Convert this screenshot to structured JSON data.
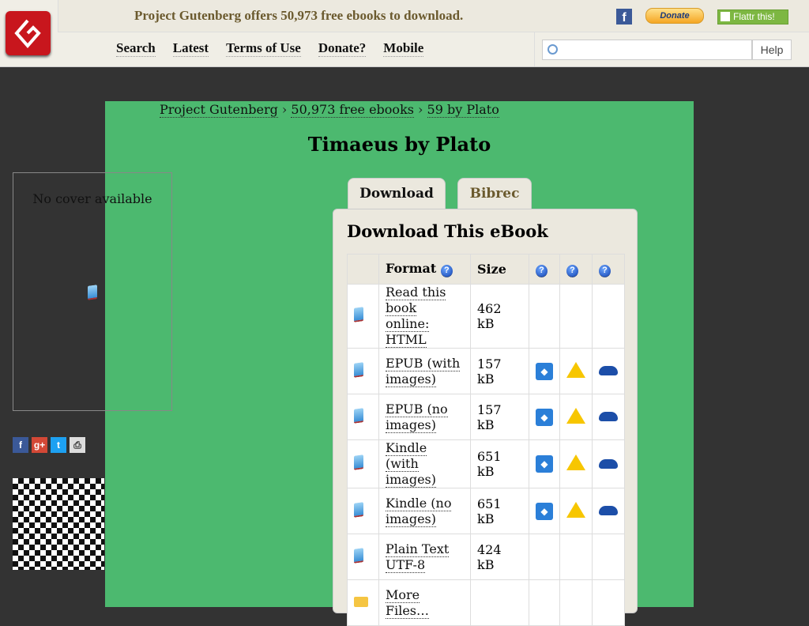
{
  "header": {
    "tagline": "Project Gutenberg offers 50,973 free ebooks to download.",
    "donate": "Donate",
    "flattr": "Flattr this!",
    "facebook": "f",
    "nav": [
      "Search",
      "Latest",
      "Terms of Use",
      "Donate?",
      "Mobile"
    ],
    "search_placeholder": "",
    "help": "Help"
  },
  "breadcrumb": [
    "Project Gutenberg",
    "50,973 free ebooks",
    "59 by Plato"
  ],
  "title": "Timaeus by Plato",
  "cover": "No cover available",
  "tabs": [
    "Download",
    "Bibrec"
  ],
  "download": {
    "heading": "Download This eBook",
    "columns": [
      "Format",
      "Size"
    ],
    "rows": [
      {
        "format": "Read this book online: HTML",
        "size": "462 kB",
        "cloud": false
      },
      {
        "format": "EPUB (with images)",
        "size": "157 kB",
        "cloud": true
      },
      {
        "format": "EPUB (no images)",
        "size": "157 kB",
        "cloud": true
      },
      {
        "format": "Kindle (with images)",
        "size": "651 kB",
        "cloud": true
      },
      {
        "format": "Kindle (no images)",
        "size": "651 kB",
        "cloud": true
      },
      {
        "format": "Plain Text UTF-8",
        "size": "424 kB",
        "cloud": false
      },
      {
        "format": "More Files…",
        "size": "",
        "cloud": false
      }
    ]
  }
}
